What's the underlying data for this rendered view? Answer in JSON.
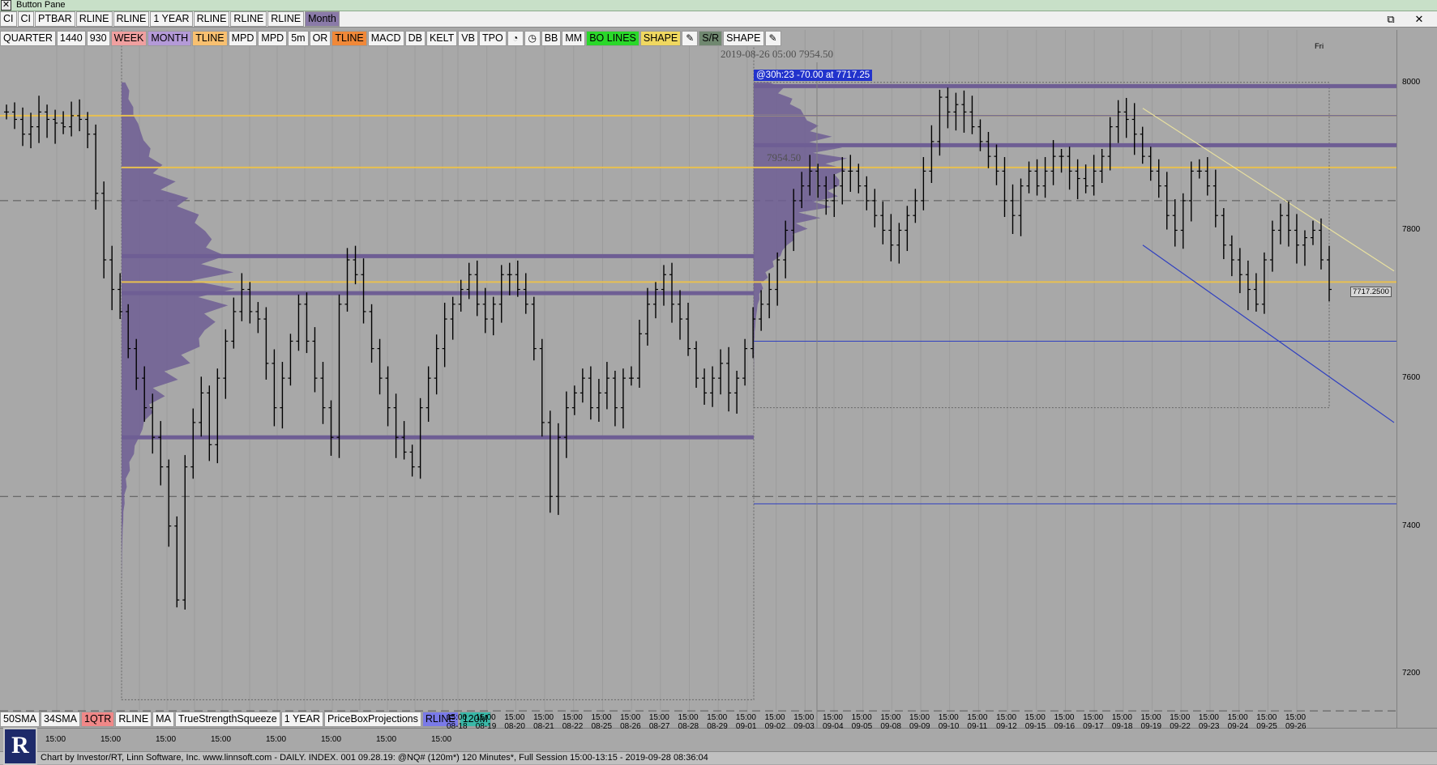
{
  "window": {
    "title": "Button Pane",
    "close_glyph": "✕"
  },
  "toolbar_top": {
    "buttons": [
      {
        "label": "CI",
        "bg": "#f4f4f4"
      },
      {
        "label": "CI",
        "bg": "#f4f4f4"
      },
      {
        "label": "PTBAR",
        "bg": "#f4f4f4"
      },
      {
        "label": "RLINE",
        "bg": "#f4f4f4"
      },
      {
        "label": "RLINE",
        "bg": "#f4f4f4"
      },
      {
        "label": "1 YEAR",
        "bg": "#f4f4f4"
      },
      {
        "label": "RLINE",
        "bg": "#f4f4f4"
      },
      {
        "label": "RLINE",
        "bg": "#f4f4f4"
      },
      {
        "label": "RLINE",
        "bg": "#f4f4f4"
      },
      {
        "label": "Month",
        "bg": "#8a7aa8"
      }
    ],
    "window_controls": [
      "⧉",
      "✕"
    ]
  },
  "toolbar_second": {
    "buttons": [
      {
        "label": "QUARTER",
        "bg": "#f4f4f4"
      },
      {
        "label": "1440",
        "bg": "#f4f4f4"
      },
      {
        "label": "930",
        "bg": "#f4f4f4"
      },
      {
        "label": "WEEK",
        "bg": "#f0a0a0"
      },
      {
        "label": "MONTH",
        "bg": "#b49ad8"
      },
      {
        "label": "TLINE",
        "bg": "#f8c070"
      },
      {
        "label": "MPD",
        "bg": "#f4f4f4"
      },
      {
        "label": "MPD",
        "bg": "#f4f4f4"
      },
      {
        "label": "5m",
        "bg": "#f4f4f4"
      },
      {
        "label": "OR",
        "bg": "#f4f4f4"
      },
      {
        "label": "TLINE",
        "bg": "#f08838"
      },
      {
        "label": "MACD",
        "bg": "#f4f4f4"
      },
      {
        "label": "DB",
        "bg": "#f4f4f4"
      },
      {
        "label": "KELT",
        "bg": "#f4f4f4"
      },
      {
        "label": "VB",
        "bg": "#f4f4f4"
      },
      {
        "label": "TPO",
        "bg": "#f4f4f4"
      },
      {
        "label": "◔",
        "bg": "#f4f4f4",
        "icon": "clock-fill-icon"
      },
      {
        "label": "◷",
        "bg": "#f4f4f4",
        "icon": "clock-icon"
      },
      {
        "label": "BB",
        "bg": "#f4f4f4"
      },
      {
        "label": "MM",
        "bg": "#f4f4f4"
      },
      {
        "label": "BO LINES",
        "bg": "#2ad82a"
      },
      {
        "label": "SHAPE",
        "bg": "#f0d860"
      },
      {
        "label": "✎",
        "bg": "#f4f4f4",
        "icon": "pencil-icon"
      },
      {
        "label": "S/R",
        "bg": "#708870"
      },
      {
        "label": "SHAPE",
        "bg": "#f4f4f4"
      },
      {
        "label": "✎",
        "bg": "#f4f4f4",
        "icon": "pencil-icon"
      }
    ],
    "collapse_glyph": "⇱"
  },
  "chart": {
    "cursor_datetime": "2019-08-26 05:00",
    "cursor_price": "7954.50",
    "cursor_info": "@30h:23  -70.00 at 7717.25",
    "price_marker": "7954.50",
    "day_label": "Fri",
    "last_price_label": "7717.2500",
    "colors": {
      "background": "#a8a8a8",
      "volume_profile": "#6e5e94",
      "month_line": "#6e5e94",
      "tline": "#e8c050",
      "blue_line": "#3040c0",
      "bars": "#000000"
    }
  },
  "chart_data": {
    "type": "ohlc",
    "instrument": "@NQ# (120m*)",
    "interval": "120 Minutes",
    "y_ticks": [
      8000,
      7800,
      7600,
      7400,
      7200
    ],
    "ylim": [
      7160,
      8060
    ],
    "x_ticks": [
      {
        "date": "08-18"
      },
      {
        "date": "08-19"
      },
      {
        "date": "08-20"
      },
      {
        "date": "08-21"
      },
      {
        "date": "08-22"
      },
      {
        "date": "08-25"
      },
      {
        "date": "08-26"
      },
      {
        "date": "08-27"
      },
      {
        "date": "08-28"
      },
      {
        "date": "08-29"
      },
      {
        "date": "09-01"
      },
      {
        "date": "09-02"
      },
      {
        "date": "09-03"
      },
      {
        "date": "09-04"
      },
      {
        "date": "09-05"
      },
      {
        "date": "09-08"
      },
      {
        "date": "09-09"
      },
      {
        "date": "09-10"
      },
      {
        "date": "09-11"
      },
      {
        "date": "09-12"
      },
      {
        "date": "09-15"
      },
      {
        "date": "09-16"
      },
      {
        "date": "09-17"
      },
      {
        "date": "09-18"
      },
      {
        "date": "09-19"
      },
      {
        "date": "09-22"
      },
      {
        "date": "09-23"
      },
      {
        "date": "09-24"
      },
      {
        "date": "09-25"
      },
      {
        "date": "09-26"
      }
    ],
    "time_label": "15:00",
    "closes": [
      7960,
      7950,
      7930,
      7940,
      7960,
      7950,
      7945,
      7940,
      7955,
      7950,
      7930,
      7850,
      7760,
      7720,
      7690,
      7640,
      7600,
      7560,
      7520,
      7480,
      7400,
      7300,
      7480,
      7540,
      7580,
      7510,
      7600,
      7650,
      7690,
      7720,
      7690,
      7680,
      7620,
      7560,
      7600,
      7650,
      7700,
      7650,
      7600,
      7560,
      7520,
      7700,
      7760,
      7740,
      7690,
      7640,
      7600,
      7560,
      7520,
      7500,
      7480,
      7560,
      7600,
      7640,
      7680,
      7700,
      7720,
      7740,
      7700,
      7680,
      7700,
      7740,
      7740,
      7720,
      7700,
      7640,
      7540,
      7440,
      7520,
      7560,
      7580,
      7600,
      7560,
      7580,
      7600,
      7560,
      7600,
      7600,
      7660,
      7700,
      7720,
      7740,
      7700,
      7680,
      7640,
      7600,
      7580,
      7600,
      7620,
      7580,
      7600,
      7640,
      7680,
      7700,
      7720,
      7760,
      7800,
      7840,
      7860,
      7880,
      7860,
      7840,
      7860,
      7880,
      7880,
      7860,
      7840,
      7820,
      7800,
      7780,
      7800,
      7820,
      7840,
      7880,
      7920,
      7980,
      7960,
      7970,
      7960,
      7940,
      7920,
      7900,
      7880,
      7840,
      7820,
      7860,
      7880,
      7860,
      7880,
      7900,
      7900,
      7880,
      7870,
      7860,
      7880,
      7900,
      7940,
      7960,
      7950,
      7930,
      7900,
      7880,
      7860,
      7820,
      7800,
      7840,
      7880,
      7880,
      7860,
      7820,
      7780,
      7760,
      7740,
      7720,
      7700,
      7760,
      7800,
      7820,
      7800,
      7780,
      7790,
      7800,
      7760,
      7720
    ],
    "levels": {
      "month_lines": [
        7995,
        7915,
        7765,
        7715,
        7520
      ],
      "tlines": [
        7955,
        7885,
        7730
      ],
      "blue_lines": [
        7955,
        7650,
        7430
      ]
    }
  },
  "bottom_toolbar": {
    "buttons": [
      {
        "label": "50SMA",
        "bg": "#f4f4f4"
      },
      {
        "label": "34SMA",
        "bg": "#f4f4f4"
      },
      {
        "label": "1QTR",
        "bg": "#f08888"
      },
      {
        "label": "RLINE",
        "bg": "#f4f4f4"
      },
      {
        "label": "MA",
        "bg": "#f4f4f4"
      },
      {
        "label": "TrueStrengthSqueeze",
        "bg": "#f4f4f4"
      },
      {
        "label": "1 YEAR",
        "bg": "#f4f4f4"
      },
      {
        "label": "PriceBoxProjections",
        "bg": "#f4f4f4"
      },
      {
        "label": "RLINE",
        "bg": "#7a7ae8"
      },
      {
        "label": "120M",
        "bg": "#3ab8a8"
      }
    ]
  },
  "status": {
    "logo_letter": "R",
    "text": "Chart by Investor/RT, Linn Software, Inc. www.linnsoft.com - DAILY. INDEX. 001  09.28.19: @NQ# (120m*) 120 Minutes*, Full Session 15:00-13:15 - 2019-09-28 08:36:04"
  }
}
